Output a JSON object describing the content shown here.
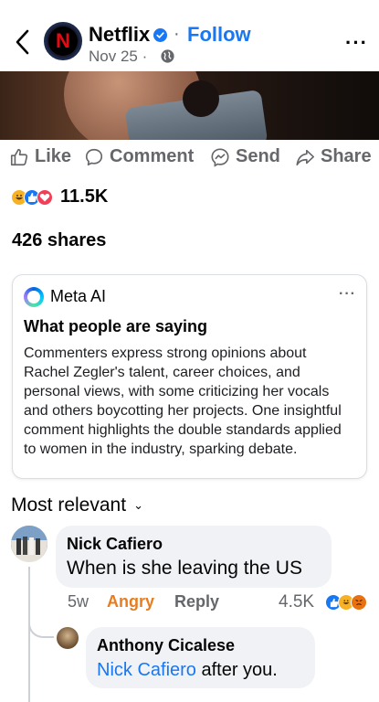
{
  "header": {
    "page_name": "Netflix",
    "avatar_letter": "N",
    "separator": "·",
    "follow_label": "Follow",
    "date": "Nov 25 ·",
    "more_label": "···"
  },
  "actions": {
    "like": "Like",
    "comment": "Comment",
    "send": "Send",
    "share": "Share"
  },
  "stats": {
    "reaction_count": "11.5K",
    "shares": "426 shares"
  },
  "meta_ai": {
    "name": "Meta AI",
    "more_label": "···",
    "title": "What people are saying",
    "summary": "Commenters express strong opinions about Rachel Zegler's talent, career choices, and personal views, with some criticizing her vocals and others boycotting her projects. One insightful comment highlights the double standards applied to women in the industry, sparking debate."
  },
  "comments_header": {
    "label": "Most relevant",
    "chevron": "⌄"
  },
  "comment": {
    "author": "Nick Cafiero",
    "text": "When is she leaving the US",
    "time": "5w",
    "reaction_label": "Angry",
    "reply_label": "Reply",
    "reaction_count": "4.5K"
  },
  "reply": {
    "author": "Anthony Cicalese",
    "mention": "Nick Cafiero",
    "text": " after you."
  },
  "colors": {
    "brand_blue": "#1877f2",
    "angry_orange": "#e87d1f",
    "muted": "#65676b",
    "bubble": "#f0f2f5",
    "netflix_red": "#e50914"
  }
}
